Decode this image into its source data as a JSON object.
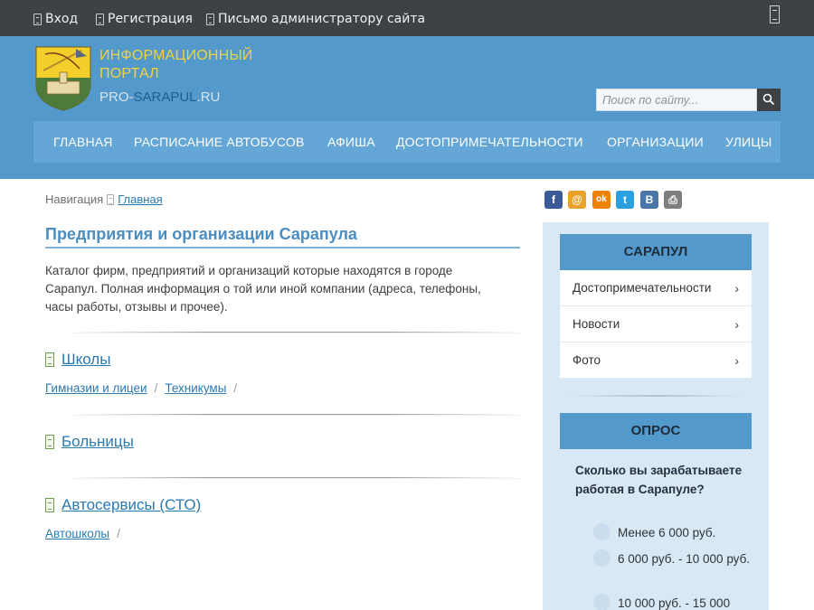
{
  "topbar": {
    "links": [
      {
        "label": "Вход",
        "icon": "login-icon"
      },
      {
        "label": "Регистрация",
        "icon": "register-icon"
      },
      {
        "label": "Письмо администратору сайта",
        "icon": "mail-icon"
      }
    ],
    "right_icon": "mobile-icon"
  },
  "header": {
    "logo_line1": "ИНФОРМАЦИОННЫЙ",
    "logo_line2": "ПОРТАЛ",
    "logo_sub_prefix": "PRO-",
    "logo_sub_mid": "SARAPUL",
    "logo_sub_suffix": ".RU",
    "search_placeholder": "Поиск по сайту...",
    "nav": [
      "ГЛАВНАЯ",
      "РАСПИСАНИЕ АВТОБУСОВ",
      "АФИША",
      "ДОСТОПРИМЕЧАТЕЛЬНОСТИ",
      "ОРГАНИЗАЦИИ",
      "УЛИЦЫ"
    ]
  },
  "main": {
    "breadcrumb_label": "Навигация",
    "breadcrumb_link": "Главная",
    "title": "Предприятия и организации Сарапула",
    "intro_line1": "Каталог фирм, предприятий и организаций которые находятся в городе",
    "intro_line2": "Сарапул. Полная информация о той или иной компании (адреса, телефоны,",
    "intro_line3": "часы работы, отзывы и прочее).",
    "categories": [
      {
        "name": "Школы",
        "subs": [
          "Гимназии и лицеи",
          "Техникумы"
        ]
      },
      {
        "name": "Больницы",
        "subs": []
      },
      {
        "name": "Автосервисы (СТО)",
        "subs": [
          "Автошколы"
        ]
      }
    ],
    "separator": "/"
  },
  "share": [
    {
      "icon": "facebook-icon",
      "glyph": "f",
      "color": "#3b5b98"
    },
    {
      "icon": "mail-ru-icon",
      "glyph": "@",
      "color": "#e8a22b"
    },
    {
      "icon": "odnoklassniki-icon",
      "glyph": "ok",
      "color": "#ee8208"
    },
    {
      "icon": "twitter-icon",
      "glyph": "t",
      "color": "#2aa1de"
    },
    {
      "icon": "vk-icon",
      "glyph": "B",
      "color": "#4a76a8"
    },
    {
      "icon": "print-icon",
      "glyph": "⎙",
      "color": "#7d7f81"
    }
  ],
  "sidebar": {
    "section1_title": "САРАПУЛ",
    "section1_items": [
      "Достопримечательности",
      "Новости",
      "Фото"
    ],
    "section2_title": "ОПРОС",
    "poll_question": "Сколько вы зарабатываете работая в Сарапуле?",
    "poll_options": [
      "Менее 6 000 руб.",
      "6 000 руб. - 10 000 руб.",
      "10 000 руб. - 15 000"
    ]
  }
}
